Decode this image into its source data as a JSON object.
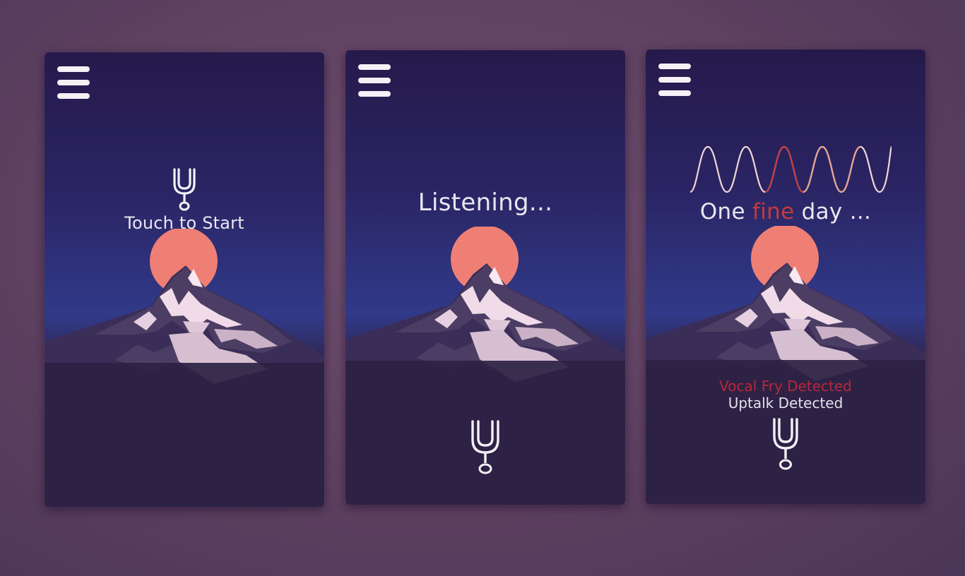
{
  "screens": [
    {
      "id": "start",
      "label": "Touch to Start"
    },
    {
      "id": "listening",
      "label": "Listening..."
    },
    {
      "id": "result",
      "phrase": {
        "before": "One ",
        "highlight": "fine",
        "after": " day ..."
      },
      "detections": [
        "Vocal Fry Detected",
        "Uptalk Detected"
      ]
    }
  ],
  "icons": {
    "menu": "hamburger-menu-icon",
    "fork": "tuning-fork-icon",
    "sun": "sun",
    "mountain": "mountain",
    "wave": "sound-wave"
  },
  "colors": {
    "sun": "#ef7f75",
    "highlight": "#c23a3c",
    "fry": "#b8263a",
    "text": "#eae6f0"
  }
}
